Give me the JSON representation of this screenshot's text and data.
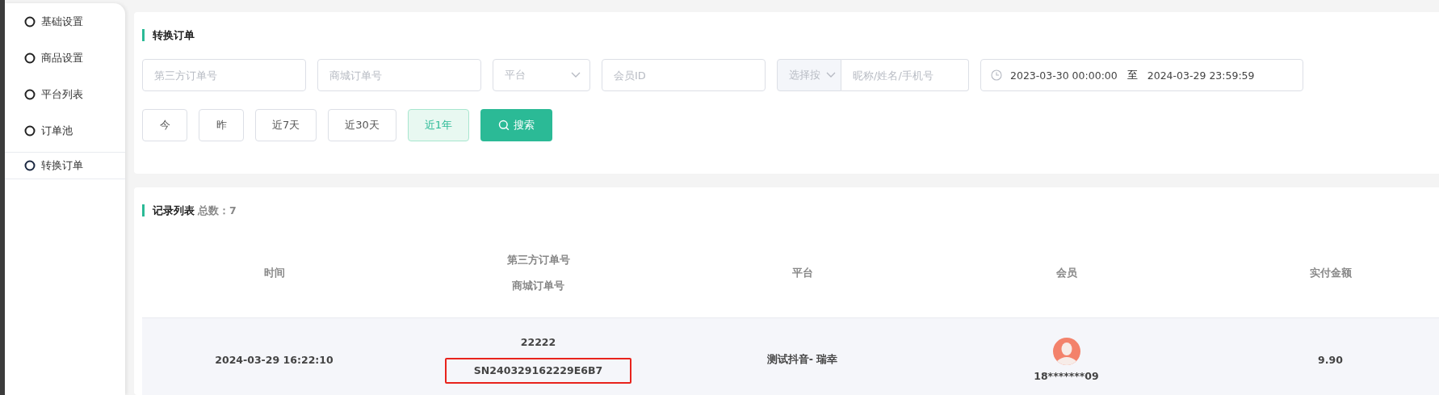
{
  "sidebar": {
    "items": [
      {
        "label": "基础设置",
        "selected": false
      },
      {
        "label": "商品设置",
        "selected": false
      },
      {
        "label": "平台列表",
        "selected": false
      },
      {
        "label": "订单池",
        "selected": false
      },
      {
        "label": "转换订单",
        "selected": true
      }
    ]
  },
  "filter_panel": {
    "title": "转换订单",
    "fields": [
      {
        "kind": "input",
        "placeholder": "第三方订单号"
      },
      {
        "kind": "input",
        "placeholder": "商城订单号"
      },
      {
        "kind": "select",
        "placeholder": "平台"
      },
      {
        "kind": "input",
        "placeholder": "会员ID"
      },
      {
        "kind": "combo",
        "select": "选择按",
        "placeholder": "昵称/姓名/手机号"
      },
      {
        "kind": "daterange",
        "start": "2023-03-30 00:00:00",
        "separator": "至",
        "end": "2024-03-29 23:59:59"
      }
    ],
    "quick_ranges": [
      {
        "label": "今",
        "selected": false
      },
      {
        "label": "昨",
        "selected": false
      },
      {
        "label": "近7天",
        "selected": false
      },
      {
        "label": "近30天",
        "selected": false
      },
      {
        "label": "近1年",
        "selected": true
      }
    ],
    "search_button": "搜索"
  },
  "records_panel": {
    "title": "记录列表",
    "total": "总数：7",
    "table": {
      "columns": [
        [
          "时间"
        ],
        [
          "第三方订单号",
          "商城订单号"
        ],
        [
          "平台"
        ],
        [
          "会员"
        ],
        [
          "实付金额"
        ]
      ],
      "rows": [
        {
          "time": "2024-03-29 16:22:10",
          "third_party_order_no": "22222",
          "mall_order_no": "SN240329162229E6B7",
          "mall_order_highlighted": true,
          "platform": "测试抖音- 瑞幸",
          "member": "18*******09",
          "amount": "9.90"
        }
      ]
    }
  }
}
